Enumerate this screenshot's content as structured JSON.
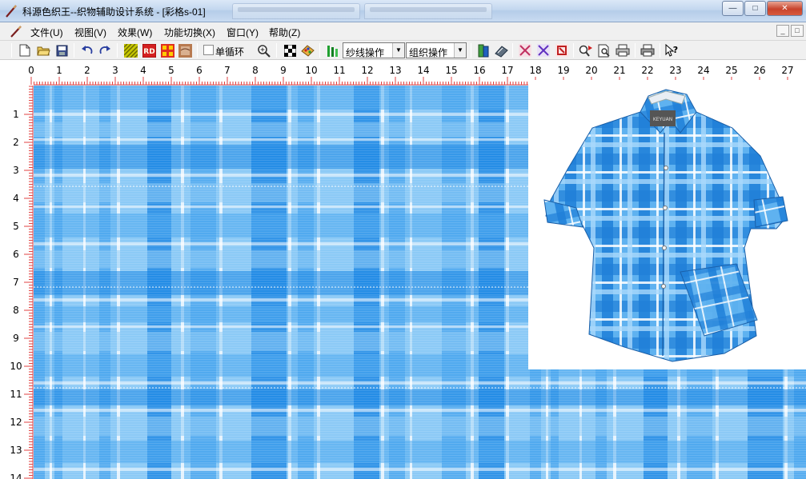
{
  "window": {
    "title": "科源色织王--织物辅助设计系统 - [彩格s-01]",
    "minimize": "—",
    "maximize": "□",
    "close": "✕"
  },
  "menubar": {
    "items": [
      "文件(U)",
      "视图(V)",
      "效果(W)",
      "功能切换(X)",
      "窗口(Y)",
      "帮助(Z)"
    ],
    "mdi_buttons": [
      "_",
      "□"
    ]
  },
  "toolbar": {
    "icons": [
      "new-icon",
      "open-icon",
      "save-icon",
      "undo-icon",
      "redo-icon",
      "weave-texture-icon",
      "rd-icon",
      "grid-color-icon",
      "fabric-view-icon",
      "zoom-icon",
      "checker-icon",
      "palette-icon",
      "yarn-icon",
      "thread-tool-icon",
      "pattern-a-icon",
      "pattern-b-icon",
      "pattern-c-icon",
      "color-swap-icon",
      "print-preview-icon",
      "print-icon",
      "printer-icon",
      "help-cursor-icon"
    ],
    "single_cycle_label": "单循环",
    "single_cycle_checked": false,
    "yarn_dropdown": "纱线操作",
    "weave_dropdown": "组织操作",
    "rd_label": "RD"
  },
  "ruler": {
    "top_labels": [
      "0",
      "1",
      "2",
      "3",
      "4",
      "5",
      "6",
      "7",
      "8",
      "9",
      "10",
      "11",
      "12",
      "13",
      "14",
      "15",
      "16",
      "17",
      "18",
      "19",
      "20",
      "21",
      "22",
      "23",
      "24",
      "25",
      "26",
      "27"
    ],
    "left_labels": [
      "1",
      "2",
      "3",
      "4",
      "5",
      "6",
      "7",
      "8",
      "9",
      "10",
      "11",
      "12",
      "13",
      "14"
    ],
    "tick_color": "#e04040"
  },
  "fabric": {
    "colors": {
      "dark_blue": "#1a86e4",
      "mid_blue": "#4aa7ee",
      "light_blue": "#8ccaf6",
      "white": "#ffffff"
    },
    "preview_label": "KEYUAN"
  }
}
